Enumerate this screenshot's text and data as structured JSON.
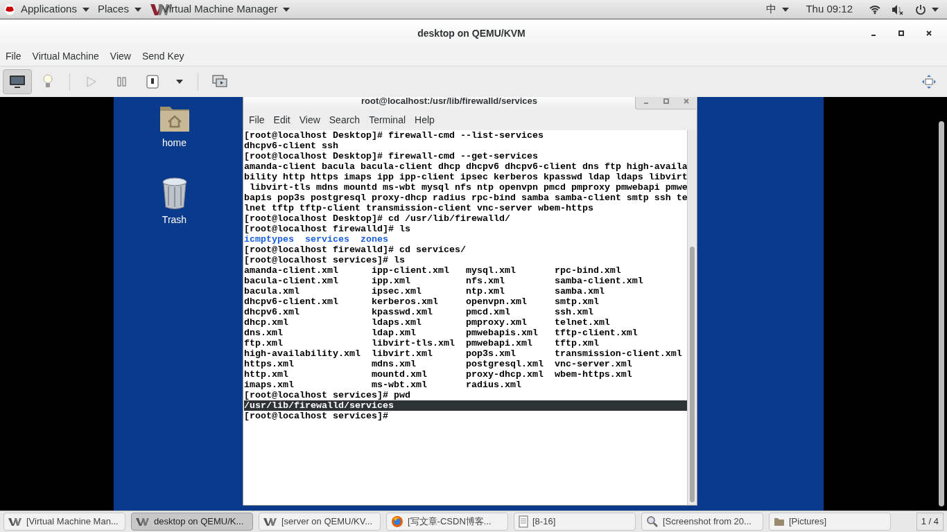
{
  "top_bar": {
    "menus": [
      {
        "label": "Applications",
        "kind": "logo"
      },
      {
        "label": "Places",
        "kind": "plain"
      },
      {
        "label": "Virtual Machine Manager",
        "kind": "vm"
      }
    ],
    "input_method": "中",
    "clock": "Thu 09:12"
  },
  "window": {
    "title": "desktop on QEMU/KVM",
    "menu": [
      "File",
      "Virtual Machine",
      "View",
      "Send Key"
    ],
    "toolbar": {
      "console_selected": true,
      "run_disabled": true
    }
  },
  "desktop": {
    "icons": [
      {
        "label": "home",
        "kind": "folder"
      },
      {
        "label": "Trash",
        "kind": "trash"
      }
    ]
  },
  "terminal": {
    "title": "root@localhost:/usr/lib/firewalld/services",
    "menu": [
      "File",
      "Edit",
      "View",
      "Search",
      "Terminal",
      "Help"
    ],
    "lines": [
      {
        "kind": "plain",
        "text": "[root@localhost Desktop]# firewall-cmd --list-services"
      },
      {
        "kind": "plain",
        "text": "dhcpv6-client ssh"
      },
      {
        "kind": "plain",
        "text": "[root@localhost Desktop]# firewall-cmd --get-services"
      },
      {
        "kind": "plain",
        "text": "amanda-client bacula bacula-client dhcp dhcpv6 dhcpv6-client dns ftp high-availa"
      },
      {
        "kind": "plain",
        "text": "bility http https imaps ipp ipp-client ipsec kerberos kpasswd ldap ldaps libvirt"
      },
      {
        "kind": "plain",
        "text": " libvirt-tls mdns mountd ms-wbt mysql nfs ntp openvpn pmcd pmproxy pmwebapi pmwe"
      },
      {
        "kind": "plain",
        "text": "bapis pop3s postgresql proxy-dhcp radius rpc-bind samba samba-client smtp ssh te"
      },
      {
        "kind": "plain",
        "text": "lnet tftp tftp-client transmission-client vnc-server wbem-https"
      },
      {
        "kind": "plain",
        "text": "[root@localhost Desktop]# cd /usr/lib/firewalld/"
      },
      {
        "kind": "plain",
        "text": "[root@localhost firewalld]# ls"
      },
      {
        "kind": "dirs",
        "items": [
          "icmptypes",
          "services",
          "zones"
        ]
      },
      {
        "kind": "plain",
        "text": "[root@localhost firewalld]# cd services/"
      },
      {
        "kind": "plain",
        "text": "[root@localhost services]# ls"
      },
      {
        "kind": "columns",
        "cells": [
          "amanda-client.xml",
          "ipp-client.xml",
          "mysql.xml",
          "rpc-bind.xml"
        ]
      },
      {
        "kind": "columns",
        "cells": [
          "bacula-client.xml",
          "ipp.xml",
          "nfs.xml",
          "samba-client.xml"
        ]
      },
      {
        "kind": "columns",
        "cells": [
          "bacula.xml",
          "ipsec.xml",
          "ntp.xml",
          "samba.xml"
        ]
      },
      {
        "kind": "columns",
        "cells": [
          "dhcpv6-client.xml",
          "kerberos.xml",
          "openvpn.xml",
          "smtp.xml"
        ]
      },
      {
        "kind": "columns",
        "cells": [
          "dhcpv6.xml",
          "kpasswd.xml",
          "pmcd.xml",
          "ssh.xml"
        ]
      },
      {
        "kind": "columns",
        "cells": [
          "dhcp.xml",
          "ldaps.xml",
          "pmproxy.xml",
          "telnet.xml"
        ]
      },
      {
        "kind": "columns",
        "cells": [
          "dns.xml",
          "ldap.xml",
          "pmwebapis.xml",
          "tftp-client.xml"
        ]
      },
      {
        "kind": "columns",
        "cells": [
          "ftp.xml",
          "libvirt-tls.xml",
          "pmwebapi.xml",
          "tftp.xml"
        ]
      },
      {
        "kind": "columns",
        "cells": [
          "high-availability.xml",
          "libvirt.xml",
          "pop3s.xml",
          "transmission-client.xml"
        ]
      },
      {
        "kind": "columns",
        "cells": [
          "https.xml",
          "mdns.xml",
          "postgresql.xml",
          "vnc-server.xml"
        ]
      },
      {
        "kind": "columns",
        "cells": [
          "http.xml",
          "mountd.xml",
          "proxy-dhcp.xml",
          "wbem-https.xml"
        ]
      },
      {
        "kind": "columns",
        "cells": [
          "imaps.xml",
          "ms-wbt.xml",
          "radius.xml"
        ]
      },
      {
        "kind": "plain",
        "text": "[root@localhost services]# pwd"
      },
      {
        "kind": "highlight",
        "text": "/usr/lib/firewalld/services"
      },
      {
        "kind": "plain",
        "text": "[root@localhost services]#"
      }
    ]
  },
  "taskbar": {
    "items": [
      {
        "label": "[Virtual Machine Man...",
        "kind": "vm",
        "selected": false
      },
      {
        "label": "desktop on QEMU/K...",
        "kind": "vm",
        "selected": true
      },
      {
        "label": "[server on QEMU/KV...",
        "kind": "vm",
        "selected": false
      },
      {
        "label": "[写文章-CSDN博客...",
        "kind": "browser",
        "selected": false
      },
      {
        "label": "[8-16]",
        "kind": "document",
        "selected": false
      },
      {
        "label": "[Screenshot from 20...",
        "kind": "viewer",
        "selected": false
      },
      {
        "label": "[Pictures]",
        "kind": "folder",
        "selected": false
      }
    ],
    "pager": "1 / 4"
  }
}
